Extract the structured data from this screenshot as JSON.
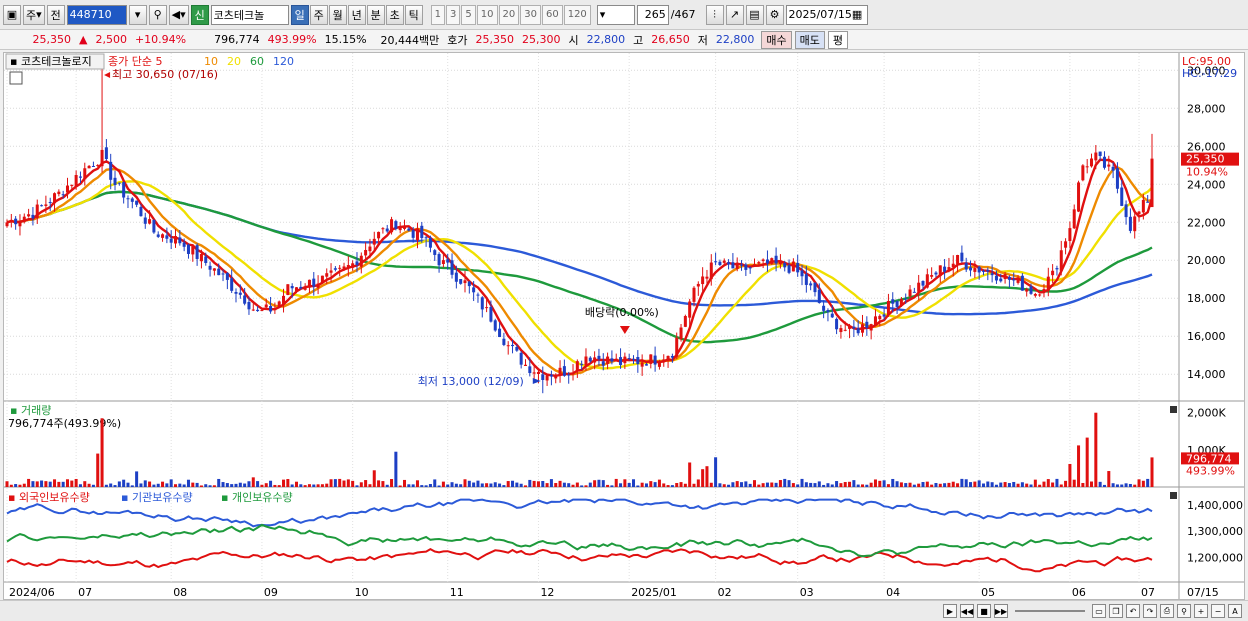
{
  "toolbar": {
    "market": "주",
    "prev": "전",
    "code": "448710",
    "new_badge": "신",
    "stock_name": "코츠테크놀",
    "periods": [
      "일",
      "주",
      "월",
      "년",
      "분",
      "초",
      "틱"
    ],
    "active_period": "일",
    "intervals": [
      "1",
      "3",
      "5",
      "10",
      "20",
      "30",
      "60",
      "120"
    ],
    "count": "265",
    "total": "/467",
    "date": "2025/07/15"
  },
  "info": {
    "price": "25,350",
    "change": "2,500",
    "change_pct": "+10.94%",
    "volume": "796,774",
    "vol_ratio": "493.99%",
    "turnover": "15.15%",
    "amount": "20,444백만",
    "ask_label": "호가",
    "ask1": "25,350",
    "ask2": "25,300",
    "open_label": "시",
    "open": "22,800",
    "high_label": "고",
    "high": "26,650",
    "low_label": "저",
    "low": "22,800",
    "buy": "매수",
    "sell": "매도",
    "pin": "평"
  },
  "chart_data": {
    "type": "candlestick",
    "title": "코츠테크놀로지",
    "ma_label": "종가 단순 5",
    "ma_periods": [
      "5",
      "10",
      "20",
      "60",
      "120"
    ],
    "ma_colors": [
      "#e01010",
      "#ee8a00",
      "#f0e000",
      "#1e9a3c",
      "#2c5ad8"
    ],
    "high_marker": "최고 30,650 (07/16)",
    "low_marker": "최저 13,000 (12/09)",
    "dividend_marker": "배당락(0.00%)",
    "lc": "LC:95.00",
    "hc": "HC:-17.29",
    "y_ticks": [
      "30,000",
      "28,000",
      "26,000",
      "24,000",
      "22,000",
      "20,000",
      "18,000",
      "16,000",
      "14,000"
    ],
    "ylim": [
      12800,
      30700
    ],
    "price_tag": "25,350",
    "price_pct": "10.94%",
    "volume_panel": {
      "label": "거래량",
      "value_text": "796,774주(493.99%)",
      "ticks": [
        "2,000K",
        "1,000K"
      ],
      "tag": "796,774",
      "tag_pct": "493.99%"
    },
    "holdings_panel": {
      "labels": [
        "외국인보유수량",
        "기관보유수량",
        "개인보유수량"
      ],
      "colors": [
        "#e01010",
        "#2c5ad8",
        "#1e9a3c"
      ],
      "ticks": [
        "1,400,000",
        "1,300,000",
        "1,200,000"
      ]
    },
    "x_labels": [
      "2024/06",
      "07",
      "08",
      "09",
      "10",
      "11",
      "12",
      "2025/01",
      "02",
      "03",
      "04",
      "05",
      "06",
      "07"
    ],
    "x_end": "07/15",
    "anchors": [
      [
        0,
        22000
      ],
      [
        6,
        22500
      ],
      [
        12,
        23500
      ],
      [
        18,
        24800
      ],
      [
        22,
        25500
      ],
      [
        25,
        24000
      ],
      [
        30,
        22800
      ],
      [
        34,
        21500
      ],
      [
        40,
        21000
      ],
      [
        48,
        19500
      ],
      [
        55,
        18000
      ],
      [
        58,
        17200
      ],
      [
        62,
        17500
      ],
      [
        65,
        18500
      ],
      [
        70,
        18800
      ],
      [
        76,
        19200
      ],
      [
        80,
        19800
      ],
      [
        85,
        21200
      ],
      [
        90,
        22000
      ],
      [
        96,
        21200
      ],
      [
        100,
        20000
      ],
      [
        106,
        18800
      ],
      [
        112,
        17000
      ],
      [
        116,
        15500
      ],
      [
        120,
        14500
      ],
      [
        124,
        14000
      ],
      [
        130,
        14200
      ],
      [
        134,
        15000
      ],
      [
        138,
        14800
      ],
      [
        142,
        14600
      ],
      [
        146,
        14700
      ],
      [
        150,
        14800
      ],
      [
        154,
        15200
      ],
      [
        158,
        17800
      ],
      [
        161,
        19200
      ],
      [
        164,
        19800
      ],
      [
        170,
        19500
      ],
      [
        176,
        19800
      ],
      [
        182,
        19600
      ],
      [
        186,
        18500
      ],
      [
        190,
        17000
      ],
      [
        195,
        16200
      ],
      [
        198,
        16500
      ],
      [
        202,
        17200
      ],
      [
        208,
        18200
      ],
      [
        212,
        18800
      ],
      [
        216,
        19500
      ],
      [
        220,
        20000
      ],
      [
        224,
        19600
      ],
      [
        230,
        19200
      ],
      [
        234,
        18800
      ],
      [
        238,
        18300
      ],
      [
        242,
        19200
      ],
      [
        246,
        21800
      ],
      [
        249,
        25000
      ],
      [
        252,
        25400
      ],
      [
        256,
        24500
      ],
      [
        260,
        21800
      ],
      [
        264,
        23200
      ],
      [
        265,
        25350
      ]
    ]
  }
}
